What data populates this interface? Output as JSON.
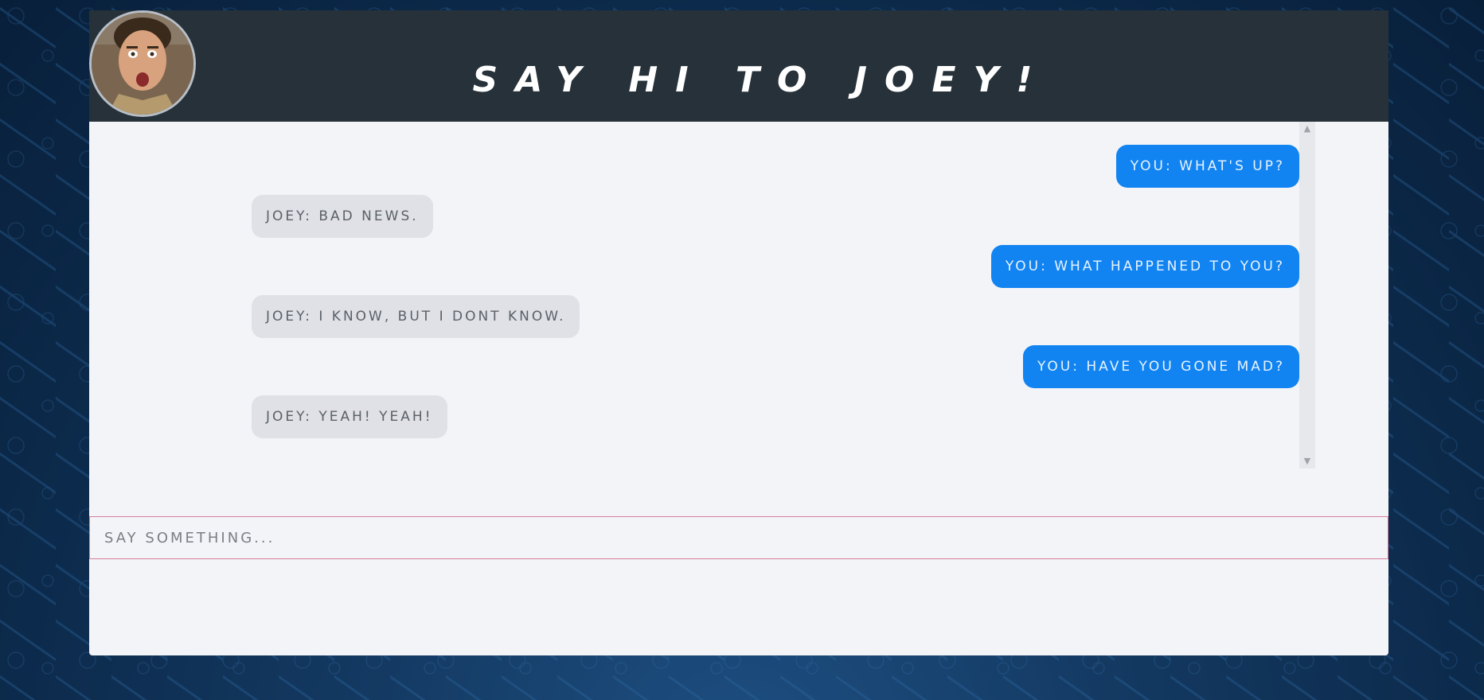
{
  "header": {
    "title": "SAY HI TO JOEY!"
  },
  "avatar": {
    "icon": "joey-avatar-photo"
  },
  "messages": [
    {
      "sender": "you",
      "text": "YOU: WHAT'S UP?"
    },
    {
      "sender": "joey",
      "text": "JOEY: BAD NEWS."
    },
    {
      "sender": "you",
      "text": "YOU: WHAT HAPPENED TO YOU?"
    },
    {
      "sender": "joey",
      "text": "JOEY: I KNOW, BUT I DONT KNOW."
    },
    {
      "sender": "you",
      "text": "YOU: HAVE YOU GONE MAD?"
    },
    {
      "sender": "joey",
      "text": "JOEY: YEAH! YEAH!"
    }
  ],
  "composer": {
    "placeholder": "SAY SOMETHING...",
    "value": ""
  },
  "colors": {
    "header_bg": "#263139",
    "you_bubble": "#1184f2",
    "joey_bubble": "#dfe1e6",
    "input_border": "#d77d9b"
  }
}
